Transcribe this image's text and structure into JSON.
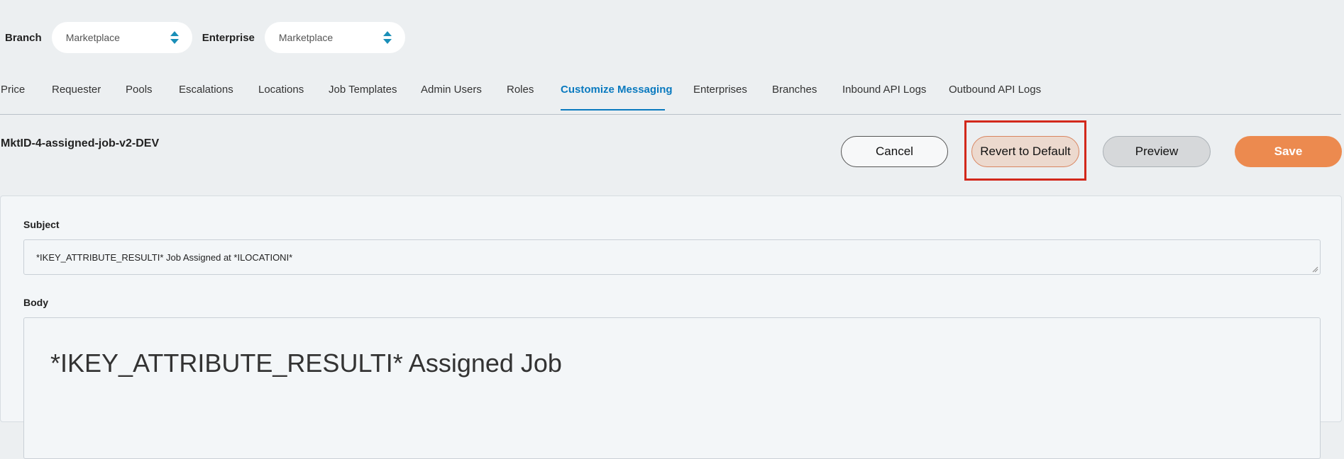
{
  "filters": {
    "branch_label": "Branch",
    "branch_value": "Marketplace",
    "enterprise_label": "Enterprise",
    "enterprise_value": "Marketplace"
  },
  "tabs": [
    {
      "label": "Price"
    },
    {
      "label": "Requester"
    },
    {
      "label": "Pools"
    },
    {
      "label": "Escalations"
    },
    {
      "label": "Locations"
    },
    {
      "label": "Job Templates"
    },
    {
      "label": "Admin Users"
    },
    {
      "label": "Roles"
    },
    {
      "label": "Customize Messaging",
      "active": true
    },
    {
      "label": "Enterprises"
    },
    {
      "label": "Branches"
    },
    {
      "label": "Inbound API Logs"
    },
    {
      "label": "Outbound API Logs"
    }
  ],
  "template": {
    "name": "MktID-4-assigned-job-v2-DEV"
  },
  "actions": {
    "cancel_label": "Cancel",
    "revert_label": "Revert to Default",
    "preview_label": "Preview",
    "save_label": "Save"
  },
  "editor": {
    "subject_label": "Subject",
    "subject_value": "*IKEY_ATTRIBUTE_RESULTI* Job Assigned at *ILOCATIONI*",
    "body_label": "Body",
    "body_heading": "*IKEY_ATTRIBUTE_RESULTI* Assigned Job"
  },
  "colors": {
    "accent": "#0a7abf",
    "save": "#ec8a4f",
    "revert": "#ecd9ce",
    "highlight": "#d2281b",
    "select_arrows": "#1a8fb8"
  },
  "icons": {
    "select_arrows": "up-down-arrows-icon",
    "resize": "resize-grip-icon"
  }
}
